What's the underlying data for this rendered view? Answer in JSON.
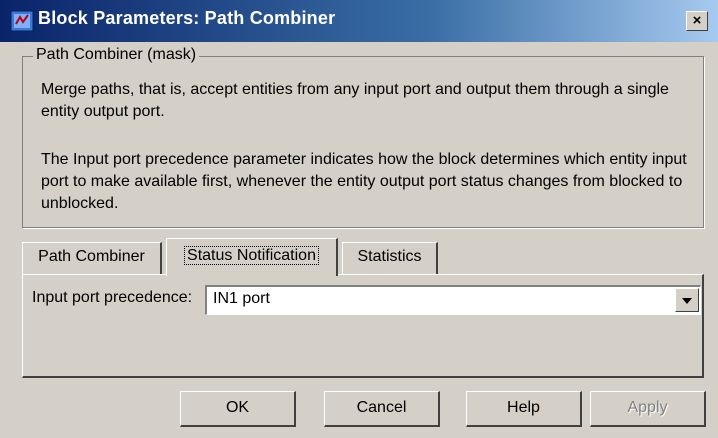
{
  "window": {
    "title": "Block Parameters: Path Combiner",
    "close_label": "×"
  },
  "group": {
    "legend": "Path Combiner (mask)",
    "paragraphs": [
      "Merge paths, that is, accept entities from any input port and output them through a single entity output port.",
      "The Input port precedence parameter indicates how the block determines which entity input port to make available first, whenever the entity output port status changes from blocked to unblocked."
    ]
  },
  "tabs": [
    {
      "label": "Path Combiner",
      "active": false
    },
    {
      "label": "Status Notification",
      "active": true
    },
    {
      "label": "Statistics",
      "active": false
    }
  ],
  "form": {
    "input_port_precedence": {
      "label": "Input port precedence:",
      "value": "IN1 port"
    }
  },
  "buttons": {
    "ok": "OK",
    "cancel": "Cancel",
    "help": "Help",
    "apply": "Apply"
  },
  "icons": {
    "title_icon": "simulink-block-icon",
    "dropdown_icon": "chevron-down-icon"
  },
  "colors": {
    "dialog_bg": "#d4d0c8",
    "titlebar_start": "#0a246a",
    "titlebar_end": "#a6caf0",
    "disabled_text": "#808080"
  }
}
